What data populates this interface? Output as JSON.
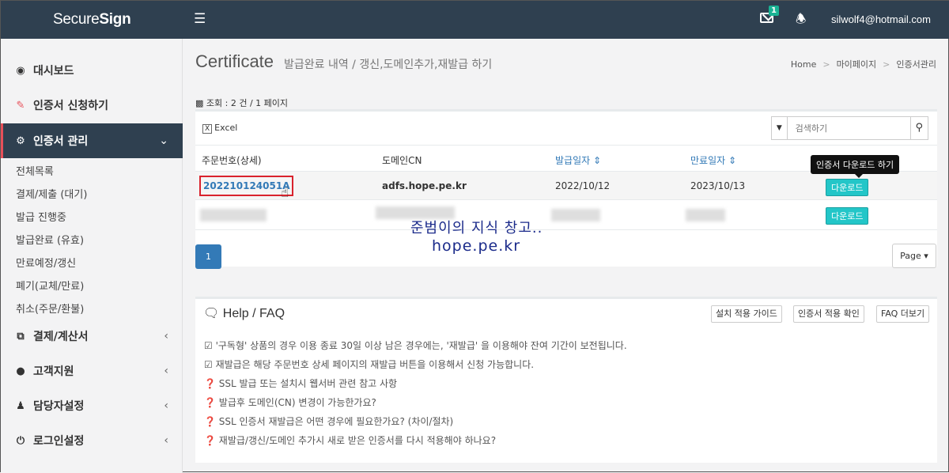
{
  "topbar": {
    "brand_plain": "Secure",
    "brand_bold": "Sign",
    "mail_count": "1",
    "user_email": "silwolf4@hotmail.com"
  },
  "sidebar": {
    "items": [
      {
        "label": "대시보드",
        "icon": "dashboard-icon"
      },
      {
        "label": "인증서 신청하기",
        "icon": "edit-icon"
      },
      {
        "label": "인증서 관리",
        "icon": "cogs-icon"
      }
    ],
    "subitems": [
      "전체목록",
      "결제/제출 (대기)",
      "발급 진행중",
      "발급완료 (유효)",
      "만료예정/갱신",
      "폐기(교체/만료)",
      "취소(주문/환불)"
    ],
    "items_bottom": [
      {
        "label": "결제/계산서",
        "icon": "copy-icon"
      },
      {
        "label": "고객지원",
        "icon": "comments-icon"
      },
      {
        "label": "담당자설정",
        "icon": "users-icon"
      },
      {
        "label": "로그인설정",
        "icon": "power-icon"
      }
    ]
  },
  "page": {
    "title": "Certificate",
    "subtitle": "발급완료 내역 / 갱신,도메인추가,재발급 하기",
    "breadcrumb": [
      "Home",
      "마이페이지",
      "인증서관리"
    ],
    "stats": "조회 : 2 건 / 1 페이지"
  },
  "table": {
    "excel_label": "Excel",
    "search_placeholder": "검색하기",
    "headers": [
      "주문번호(상세)",
      "도메인CN",
      "발급일자",
      "만료일자"
    ],
    "rows": [
      {
        "order": "202210124051A",
        "domain": "adfs.hope.pe.kr",
        "issued": "2022/10/12",
        "expires": "2023/10/13",
        "button": "다운로드"
      },
      {
        "order": "",
        "domain": "",
        "issued": "",
        "expires": "",
        "button": "다운로드"
      }
    ],
    "tooltip": "인증서 다운로드 하기"
  },
  "pagination": {
    "current": "1",
    "page_dropdown": "Page"
  },
  "watermark": {
    "line1": "준범이의 지식 창고..",
    "line2": "hope.pe.kr"
  },
  "help": {
    "title": "Help / FAQ",
    "buttons": [
      "설치 적용 가이드",
      "인증서 적용 확인",
      "FAQ 더보기"
    ],
    "lines": [
      "'구독형' 상품의 경우 이용 종료 30일 이상 남은 경우에는, '재발급' 을 이용해야 잔여 기간이 보전됩니다.",
      "재발급은 해당 주문번호 상세 페이지의 재발급 버튼을 이용해서 신청 가능합니다.",
      "SSL 발급 또는 설치시 웹서버 관련 참고 사항",
      "발급후 도메인(CN) 변경이 가능한가요?",
      "SSL 인증서 재발급은 어떤 경우에 필요한가요? (차이/절차)",
      "재발급/갱신/도메인 추가시 새로 받은 인증서를 다시 적용해야 하나요?"
    ]
  }
}
